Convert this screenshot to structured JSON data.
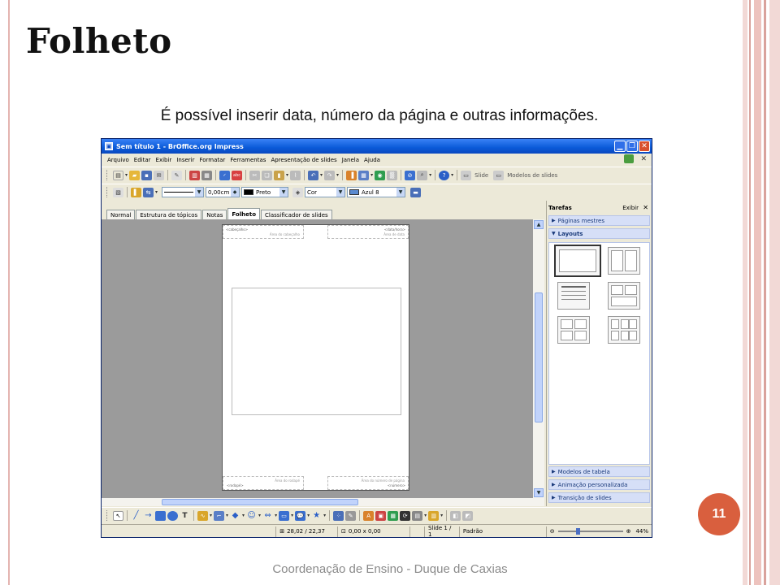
{
  "slide": {
    "title": "Folheto",
    "subtitle": "É possível inserir data, número da página e outras informações.",
    "footer": "Coordenação de Ensino - Duque de Caxias",
    "page_number": "11",
    "colors": {
      "accent": "#d95f3e",
      "frame": "#e4b4b0"
    }
  },
  "window": {
    "title": "Sem título 1 - BrOffice.org Impress",
    "minimize_icon": "minimize-icon",
    "maximize_icon": "maximize-icon",
    "close_icon": "close-icon"
  },
  "menu": {
    "items": [
      "Arquivo",
      "Editar",
      "Exibir",
      "Inserir",
      "Formatar",
      "Ferramentas",
      "Apresentação de slides",
      "Janela",
      "Ajuda"
    ],
    "close_glyph": "✕"
  },
  "toolbar": {
    "slide_label": "Slide",
    "layouts_label": "Modelos de slides",
    "line_width": "0,00cm",
    "line_color": "Preto",
    "area_style": "Cor",
    "area_color": "Azul 8",
    "colors": {
      "preto": "#000000",
      "azul8": "#5a8ad0"
    }
  },
  "view_tabs": [
    "Normal",
    "Estrutura de tópicos",
    "Notas",
    "Folheto",
    "Classificador de slides"
  ],
  "active_tab": "Folheto",
  "handout_page": {
    "header_label": "<cabeçalho>",
    "header_area": "Área do cabeçalho",
    "date_label": "<data/hora>",
    "date_area": "Área de data",
    "footer_label": "<rodapé>",
    "footer_area": "Área do rodapé",
    "number_label": "<número>",
    "number_area": "Área do número de página"
  },
  "task_pane": {
    "title": "Tarefas",
    "view_menu": "Exibir",
    "sections": {
      "master_pages": "Páginas mestres",
      "layouts": "Layouts",
      "table_design": "Modelos de tabela",
      "custom_animation": "Animação personalizada",
      "slide_transition": "Transição de slides"
    }
  },
  "status": {
    "position": "28,02 / 22,37",
    "size": "0,00 x 0,00",
    "slide": "Slide 1 / 1",
    "master": "Padrão",
    "zoom": "44%"
  }
}
